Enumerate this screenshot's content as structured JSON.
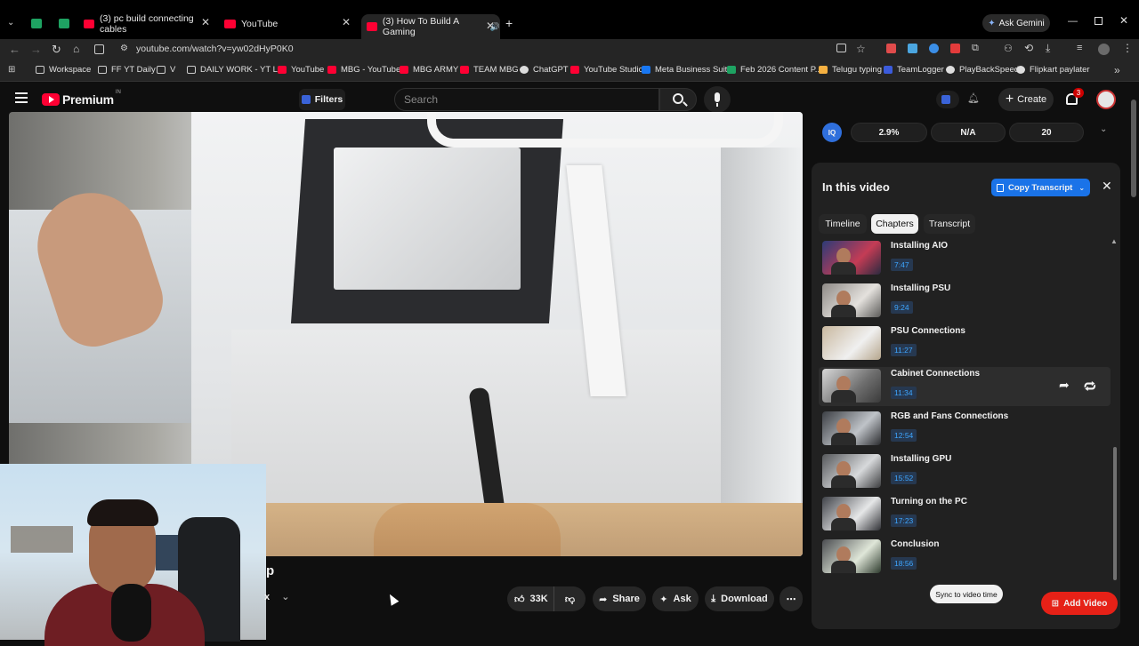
{
  "browser": {
    "tabs": [
      {
        "label": "(3) pc build connecting cables",
        "color": "#ff0033"
      },
      {
        "label": "YouTube",
        "color": "#ff0033"
      },
      {
        "label": "(3) How To Build A Gaming",
        "color": "#ff0033"
      }
    ],
    "new_tab": "+",
    "close": "✕",
    "gemini": "Ask Gemini",
    "url": "youtube.com/watch?v=yw02dHyP0K0",
    "bookmarks": [
      "Workspace",
      "FF YT Daily",
      "V",
      "DAILY WORK - YT L...",
      "YouTube",
      "MBG - YouTube",
      "MBG ARMY",
      "TEAM MBG",
      "ChatGPT",
      "YouTube Studio",
      "Meta Business Suite",
      "Feb 2026 Content P...",
      "Telugu typing",
      "TeamLogger",
      "PlayBackSpeed",
      "Flipkart paylater"
    ],
    "more": "»"
  },
  "yt": {
    "logo": "Premium",
    "logo_badge": "IN",
    "filters": "Filters",
    "search_placeholder": "Search",
    "create": "Create",
    "notif_count": "3"
  },
  "video": {
    "title_fragment": "p",
    "partial_text": "x",
    "actions": {
      "likes": "33K",
      "share": "Share",
      "ask": "Ask",
      "download": "Download"
    }
  },
  "panel": {
    "metric_icon": "IQ",
    "metrics": [
      "2.9%",
      "N/A",
      "20"
    ],
    "title": "In this video",
    "copy_transcript": "Copy Transcript",
    "tabs": [
      "Timeline",
      "Chapters",
      "Transcript"
    ],
    "chapters": [
      {
        "title": "Installing AIO",
        "time": "7:47"
      },
      {
        "title": "Installing PSU",
        "time": "9:24"
      },
      {
        "title": "PSU Connections",
        "time": "11:27"
      },
      {
        "title": "Cabinet Connections",
        "time": "11:34"
      },
      {
        "title": "RGB and Fans Connections",
        "time": "12:54"
      },
      {
        "title": "Installing GPU",
        "time": "15:52"
      },
      {
        "title": "Turning on the PC",
        "time": "17:23"
      },
      {
        "title": "Conclusion",
        "time": "18:56"
      }
    ],
    "sync": "Sync to video time",
    "add_video": "Add Video"
  },
  "colors": {
    "youtube_red": "#ff0033",
    "blue_accent": "#1a73e8",
    "chapter_time": "#3ea6ff"
  }
}
